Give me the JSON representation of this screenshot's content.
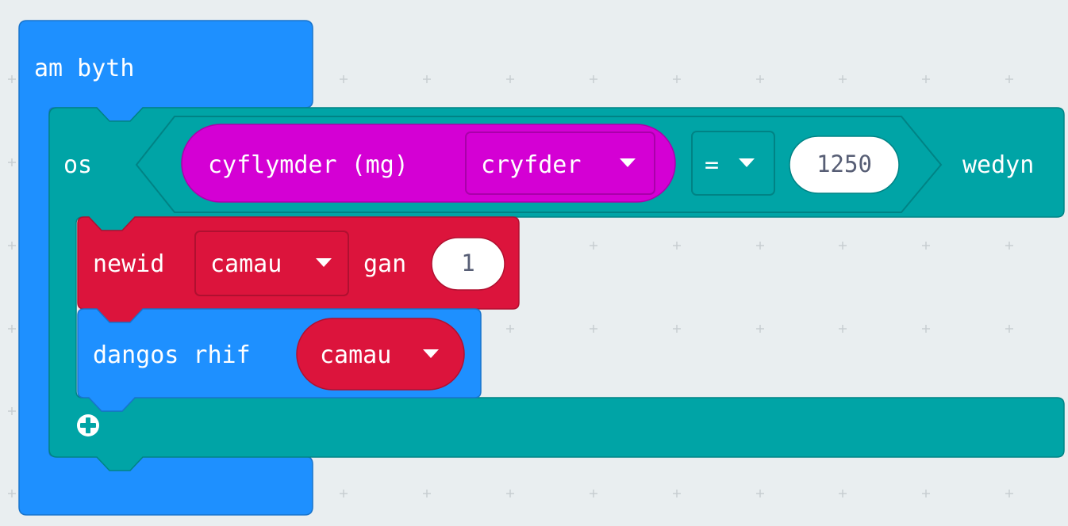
{
  "colors": {
    "workspace_bg": "#e9eef0",
    "grid_plus": "#c7cdd1",
    "basic_blue": "#1e90ff",
    "basic_blue_border": "#1874cc",
    "logic_teal": "#00a4a6",
    "logic_teal_border": "#008385",
    "input_magenta": "#d400d4",
    "input_magenta_border": "#aa00aa",
    "variables_red": "#dc143c",
    "variables_red_border": "#b01030",
    "value_bg": "#ffffff",
    "value_text": "#575e75"
  },
  "forever_block": {
    "label": "am byth"
  },
  "if_block": {
    "if_label": "os",
    "then_label": "wedyn",
    "add_icon": "plus-circle-icon"
  },
  "acceleration_block": {
    "label": "cyflymder (mg)",
    "dimension_dropdown": "cryfder",
    "dropdown_icon": "caret-down-icon"
  },
  "compare_block": {
    "operator": "=",
    "value": "1250"
  },
  "change_block": {
    "change_label": "newid",
    "variable": "camau",
    "by_label": "gan",
    "value": "1"
  },
  "show_number_block": {
    "label": "dangos rhif",
    "variable": "camau"
  }
}
